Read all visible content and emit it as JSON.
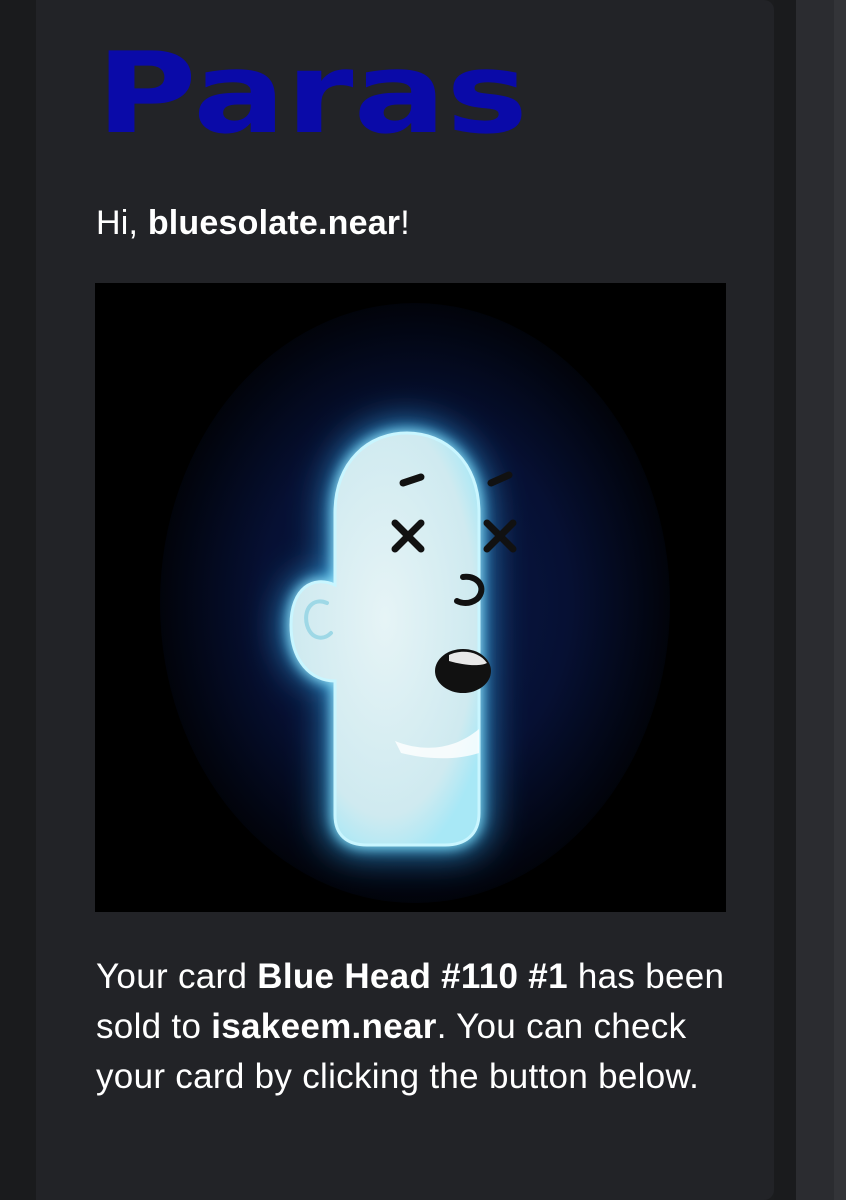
{
  "logo": {
    "text": "Paras",
    "color": "#0a0aa8"
  },
  "greeting": {
    "prefix": "Hi, ",
    "username": "bluesolate.near",
    "suffix": "!"
  },
  "nft_image": {
    "alt": "Blue Head #110 #1"
  },
  "message": {
    "part1": "Your card ",
    "card_name": "Blue Head #110 #1",
    "part2": " has been sold to ",
    "buyer": "isakeem.near",
    "part3": ". You can check your card by clicking the button below."
  },
  "colors": {
    "page_background": "#1b1c1e",
    "card_background": "#222327",
    "text": "#ffffff",
    "glow": "#7fe0ff"
  }
}
